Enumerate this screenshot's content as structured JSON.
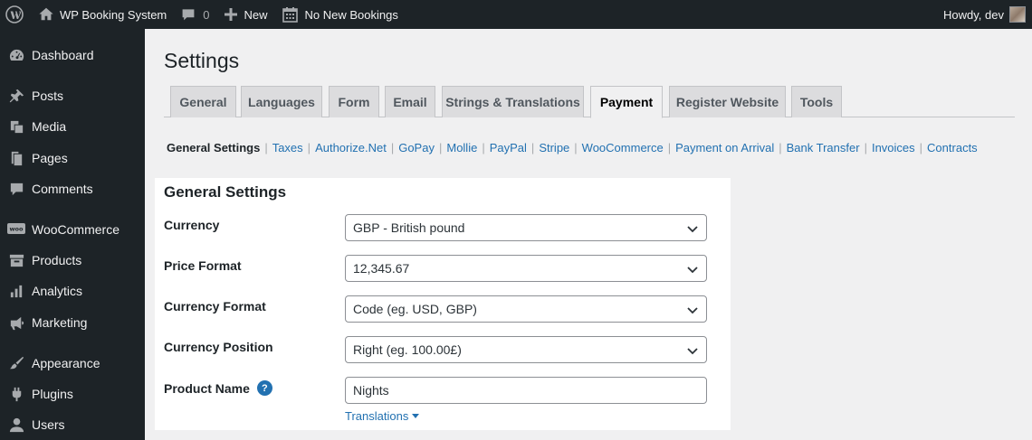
{
  "adminbar": {
    "site_name": "WP Booking System",
    "comments_count": "0",
    "new_label": "New",
    "bookings_label": "No New Bookings",
    "howdy": "Howdy, dev"
  },
  "sidebar": {
    "items": [
      {
        "label": "Dashboard",
        "icon": "dashboard-icon"
      },
      {
        "label": "Posts",
        "icon": "pin-icon"
      },
      {
        "label": "Media",
        "icon": "media-icon"
      },
      {
        "label": "Pages",
        "icon": "pages-icon"
      },
      {
        "label": "Comments",
        "icon": "comment-icon"
      },
      {
        "label": "WooCommerce",
        "icon": "woo-icon"
      },
      {
        "label": "Products",
        "icon": "archive-icon"
      },
      {
        "label": "Analytics",
        "icon": "bar-chart-icon"
      },
      {
        "label": "Marketing",
        "icon": "megaphone-icon"
      },
      {
        "label": "Appearance",
        "icon": "brush-icon"
      },
      {
        "label": "Plugins",
        "icon": "plugin-icon"
      },
      {
        "label": "Users",
        "icon": "user-icon"
      }
    ]
  },
  "page": {
    "title": "Settings",
    "tabs": [
      {
        "label": "General"
      },
      {
        "label": "Languages"
      },
      {
        "label": "Form"
      },
      {
        "label": "Email"
      },
      {
        "label": "Strings & Translations"
      },
      {
        "label": "Payment",
        "active": true
      },
      {
        "label": "Register Website"
      },
      {
        "label": "Tools"
      }
    ],
    "subnav": [
      {
        "label": "General Settings",
        "current": true
      },
      {
        "label": "Taxes"
      },
      {
        "label": "Authorize.Net"
      },
      {
        "label": "GoPay"
      },
      {
        "label": "Mollie"
      },
      {
        "label": "PayPal"
      },
      {
        "label": "Stripe"
      },
      {
        "label": "WooCommerce"
      },
      {
        "label": "Payment on Arrival"
      },
      {
        "label": "Bank Transfer"
      },
      {
        "label": "Invoices"
      },
      {
        "label": "Contracts"
      }
    ]
  },
  "panel": {
    "title": "General Settings",
    "currency": {
      "label": "Currency",
      "value": "GBP - British pound"
    },
    "price_format": {
      "label": "Price Format",
      "value": "12,345.67"
    },
    "currency_format": {
      "label": "Currency Format",
      "value": "Code (eg. USD, GBP)"
    },
    "currency_position": {
      "label": "Currency Position",
      "value": "Right (eg. 100.00£)"
    },
    "product_name": {
      "label": "Product Name",
      "value": "Nights",
      "help": "?"
    },
    "translations_link": "Translations"
  },
  "colors": {
    "admin_bar_bg": "#1d2327",
    "link": "#2271b1",
    "page_bg": "#f0f0f1"
  }
}
